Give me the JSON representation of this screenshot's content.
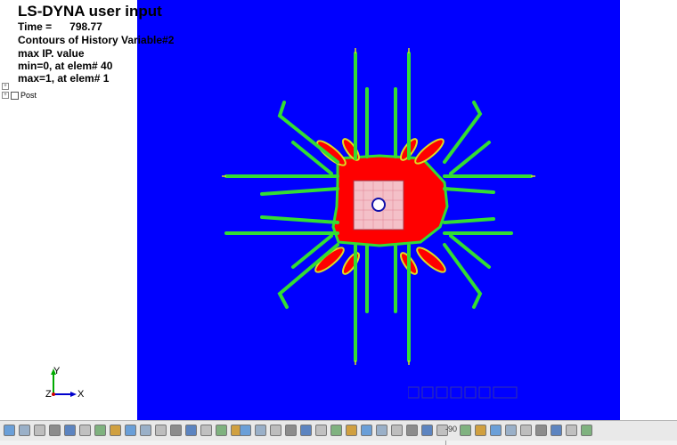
{
  "header": {
    "title": "LS-DYNA user input",
    "time_label": "Time =",
    "time_value": "798.77",
    "contour_label": "Contours of History Variable#2",
    "value_mode": "max IP. value",
    "min_line": "min=0, at elem# 40",
    "max_line": "max=1, at elem# 1"
  },
  "tree": {
    "root_label": "Post"
  },
  "triad": {
    "y_axis": "Y",
    "z_axis": "Z",
    "x_axis": "X"
  },
  "toolbar": {
    "items": [
      "mesh-icon",
      "solid-icon",
      "wire-icon",
      "hidden-icon",
      "shade-icon",
      "feature-icon",
      "edge-icon",
      "grid-icon",
      "cube-icon",
      "cube-icon",
      "cube-icon",
      "cube-icon",
      "cube-icon",
      "cube-icon",
      "palette-icon",
      "dropdown-icon",
      "unit-icon",
      "cube-icon",
      "cube-icon",
      "cube-icon",
      "mesh-icon",
      "text-icon",
      "marker-icon",
      "plus-icon",
      "minus-icon",
      "zoom-icon",
      "rotate-icon",
      "globe-icon",
      "cube-icon",
      "dropdown-icon",
      "angle-icon",
      "cube-icon",
      "house-icon",
      "light-icon",
      "checker-icon",
      "sphere-icon",
      "mesh-icon",
      "picture-icon",
      "chat-icon"
    ],
    "angle_text": "-90"
  },
  "colors": {
    "background_low": "#0000ff",
    "damage_high": "#ff0000",
    "transition_green": "#33dd33",
    "transition_yellow": "#dddd22",
    "accent": "#00ffff"
  }
}
